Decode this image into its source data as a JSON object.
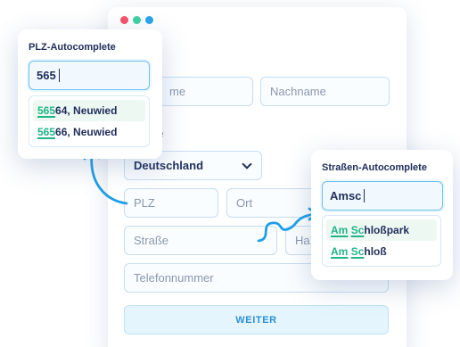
{
  "colors": {
    "dot_red": "#f2546a",
    "dot_green": "#3fd0a4",
    "dot_blue": "#2ba3ea",
    "accent_blue": "#2b8fd6",
    "match_green": "#21b487",
    "arrow_blue": "#1e9ee8"
  },
  "form": {
    "firstname_placeholder_visible": "me",
    "lastname_placeholder": "Nachname",
    "address_section_label_visible": "e",
    "country_value": "Deutschland",
    "plz_placeholder": "PLZ",
    "ort_placeholder": "Ort",
    "street_placeholder": "Straße",
    "housenumber_placeholder_visible": "Ha",
    "phone_placeholder": "Telefonnummer",
    "submit_label": "WEITER"
  },
  "plz_popup": {
    "title": "PLZ-Autocomplete",
    "input_value": "565",
    "suggestions": [
      {
        "match": "565",
        "rest_code": "64",
        "suffix": ", Neuwied"
      },
      {
        "match": "565",
        "rest_code": "66",
        "suffix": ", Neuwied"
      }
    ]
  },
  "street_popup": {
    "title": "Straßen-Autocomplete",
    "input_value": "Amsc",
    "suggestions": [
      {
        "match1": "Am",
        "space": " ",
        "match2": "Sc",
        "rest": "hloßpark"
      },
      {
        "match1": "Am",
        "space": " ",
        "match2": "Sc",
        "rest": "hloß"
      }
    ]
  }
}
